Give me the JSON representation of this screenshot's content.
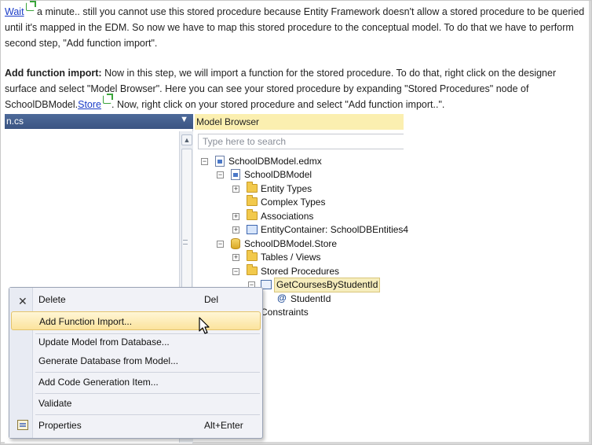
{
  "article": {
    "p1": {
      "link": "Wait",
      "text": " a minute.. still you cannot use this stored procedure because Entity Framework doesn't allow a stored procedure to be queried until it's mapped in the EDM. So now we have to map this stored procedure to the conceptual model. To do that we have to perform second step, \"Add function import\"."
    },
    "p2": {
      "heading": "Add function import:",
      "text_a": " Now in this step, we will import a function for the stored procedure. To do that, right click on the designer surface and select \"Model Browser\". Here you can see your stored procedure by expanding \"Stored Procedures\" node of SchoolDBModel.",
      "link": "Store",
      "text_b": ". Now, right click on your stored procedure and select \"Add function import..\"."
    }
  },
  "editor": {
    "tab_label": "n.cs",
    "dropdown_glyph": "▼"
  },
  "model_browser": {
    "title": "Model Browser",
    "search_placeholder": "Type here to search",
    "tree": {
      "root": "SchoolDBModel.edmx",
      "model": "SchoolDBModel",
      "entity_types": "Entity Types",
      "complex_types": "Complex Types",
      "associations": "Associations",
      "entity_container": "EntityContainer: SchoolDBEntities4",
      "store": "SchoolDBModel.Store",
      "tables_views": "Tables / Views",
      "stored_procedures": "Stored Procedures",
      "procedure": "GetCoursesByStudentId",
      "parameter": "StudentId",
      "constraints": "Constraints"
    }
  },
  "context_menu": {
    "delete": "Delete",
    "delete_shortcut": "Del",
    "add_function_import": "Add Function Import...",
    "update_model": "Update Model from Database...",
    "generate_db": "Generate Database from Model...",
    "add_code_gen": "Add Code Generation Item...",
    "validate": "Validate",
    "properties": "Properties",
    "properties_shortcut": "Alt+Enter"
  },
  "colors": {
    "link": "#1a3cc8",
    "model_browser_header": "#fbefb0",
    "menu_highlight": "#fbe39c",
    "editor_tab": "#3b5482"
  }
}
